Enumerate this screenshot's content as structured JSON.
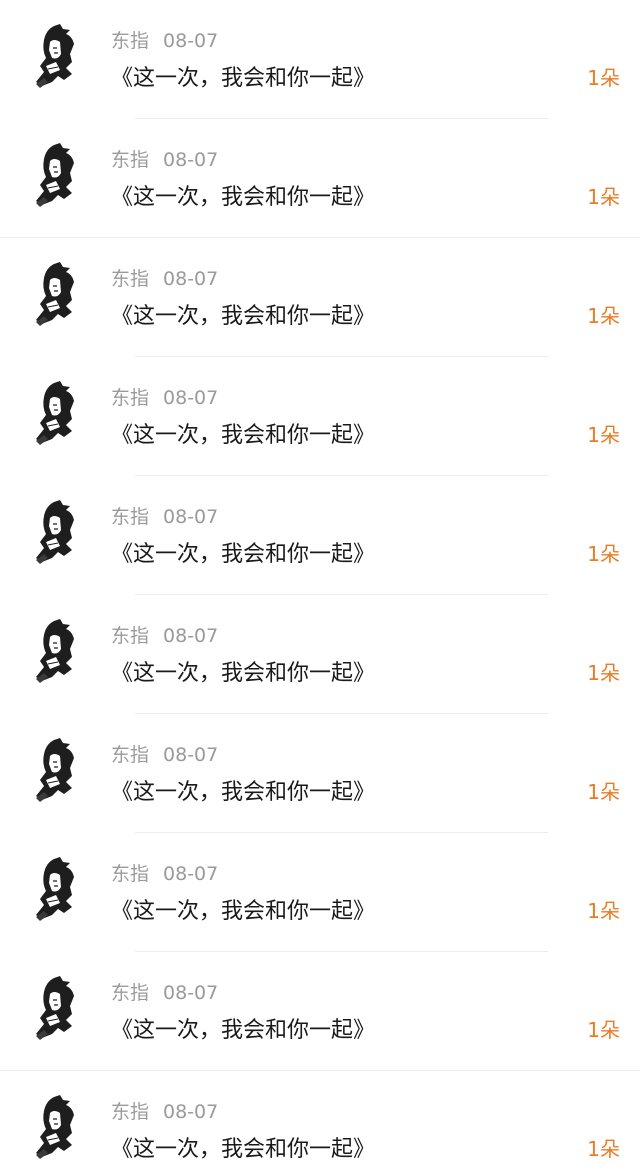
{
  "items": [
    {
      "author": "东指",
      "date": "08-07",
      "title": "《这一次，我会和你一起》",
      "gift": "1朵"
    },
    {
      "author": "东指",
      "date": "08-07",
      "title": "《这一次，我会和你一起》",
      "gift": "1朵"
    },
    {
      "author": "东指",
      "date": "08-07",
      "title": "《这一次，我会和你一起》",
      "gift": "1朵"
    },
    {
      "author": "东指",
      "date": "08-07",
      "title": "《这一次，我会和你一起》",
      "gift": "1朵"
    },
    {
      "author": "东指",
      "date": "08-07",
      "title": "《这一次，我会和你一起》",
      "gift": "1朵"
    },
    {
      "author": "东指",
      "date": "08-07",
      "title": "《这一次，我会和你一起》",
      "gift": "1朵"
    },
    {
      "author": "东指",
      "date": "08-07",
      "title": "《这一次，我会和你一起》",
      "gift": "1朵"
    },
    {
      "author": "东指",
      "date": "08-07",
      "title": "《这一次，我会和你一起》",
      "gift": "1朵"
    },
    {
      "author": "东指",
      "date": "08-07",
      "title": "《这一次，我会和你一起》",
      "gift": "1朵"
    },
    {
      "author": "东指",
      "date": "08-07",
      "title": "《这一次，我会和你一起》",
      "gift": "1朵"
    }
  ],
  "colors": {
    "gift_accent": "#ee7a22",
    "meta_text": "#9a9a9a",
    "title_text": "#1a1a1a"
  },
  "icons": {
    "avatar": "ink-portrait-avatar"
  }
}
